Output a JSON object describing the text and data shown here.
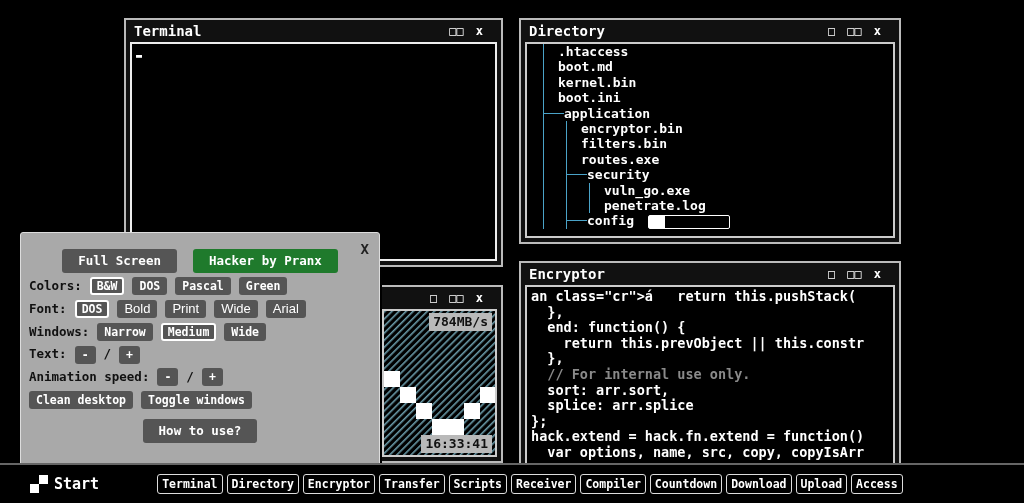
{
  "terminal": {
    "title": "Terminal",
    "buttons": [
      "□□",
      "x"
    ],
    "cursor": "▬"
  },
  "directory": {
    "title": "Directory",
    "buttons": [
      "□",
      "□□",
      "x"
    ],
    "tree": [
      {
        "name": ".htaccess",
        "kind": "file"
      },
      {
        "name": "boot.md",
        "kind": "file"
      },
      {
        "name": "kernel.bin",
        "kind": "file"
      },
      {
        "name": "boot.ini",
        "kind": "file"
      },
      {
        "name": "application",
        "kind": "folder",
        "children": [
          {
            "name": "encryptor.bin",
            "kind": "file"
          },
          {
            "name": "filters.bin",
            "kind": "file"
          },
          {
            "name": "routes.exe",
            "kind": "file"
          },
          {
            "name": "security",
            "kind": "folder",
            "children": [
              {
                "name": "vuln_go.exe",
                "kind": "file"
              },
              {
                "name": "penetrate.log",
                "kind": "file"
              }
            ]
          },
          {
            "name": "config",
            "kind": "folder",
            "level": 0.2
          }
        ]
      }
    ]
  },
  "encryptor": {
    "title": "Encryptor",
    "buttons": [
      "□",
      "□□",
      "x"
    ],
    "lines": [
      {
        "text": "an class=\"cr\">á   return this.pushStack(",
        "kind": "code"
      },
      {
        "text": "  },",
        "kind": "code"
      },
      {
        "text": "  end: function() {",
        "kind": "code"
      },
      {
        "text": "    return this.prevObject || this.constr",
        "kind": "code"
      },
      {
        "text": "  },",
        "kind": "code"
      },
      {
        "text": "  // For internal use only.",
        "kind": "comment"
      },
      {
        "text": "  sort: arr.sort,",
        "kind": "code"
      },
      {
        "text": "  splice: arr.splice",
        "kind": "code"
      },
      {
        "text": "};",
        "kind": "code"
      },
      {
        "text": "hack.extend = hack.fn.extend = function()",
        "kind": "code"
      },
      {
        "text": "  var options, name, src, copy, copyIsArr",
        "kind": "code"
      }
    ]
  },
  "transfer": {
    "buttons": [
      "□",
      "□□",
      "x"
    ],
    "speed": "784MB/s",
    "time": "16:33:41"
  },
  "settings": {
    "close": "X",
    "top_buttons": [
      {
        "label": "Full Screen",
        "kind": "plain"
      },
      {
        "label": "Hacker by Pranx",
        "kind": "accent"
      }
    ],
    "rows": [
      {
        "label": "Colors:",
        "kind": "options",
        "options": [
          {
            "label": "B&W",
            "selected": true,
            "kind": "mono"
          },
          {
            "label": "DOS",
            "selected": false,
            "kind": "mono"
          },
          {
            "label": "Pascal",
            "selected": false,
            "kind": "mono"
          },
          {
            "label": "Green",
            "selected": false,
            "kind": "mono"
          }
        ]
      },
      {
        "label": "Font:",
        "kind": "options",
        "options": [
          {
            "label": "DOS",
            "selected": true,
            "kind": "mono"
          },
          {
            "label": "Bold",
            "selected": false,
            "kind": "sans"
          },
          {
            "label": "Print",
            "selected": false,
            "kind": "sans"
          },
          {
            "label": "Wide",
            "selected": false,
            "kind": "sans"
          },
          {
            "label": "Arial",
            "selected": false,
            "kind": "sans"
          }
        ]
      },
      {
        "label": "Windows:",
        "kind": "options",
        "options": [
          {
            "label": "Narrow",
            "selected": false,
            "kind": "mono"
          },
          {
            "label": "Medium",
            "selected": true,
            "kind": "mono"
          },
          {
            "label": "Wide",
            "selected": false,
            "kind": "mono"
          }
        ]
      },
      {
        "label": "Text:",
        "kind": "stepper",
        "minus": "-",
        "separator": "/",
        "plus": "+"
      },
      {
        "label": "Animation speed:",
        "kind": "stepper",
        "minus": "-",
        "separator": "/",
        "plus": "+"
      },
      {
        "kind": "actions",
        "buttons": [
          "Clean desktop",
          "Toggle windows"
        ]
      }
    ],
    "help": "How to use?"
  },
  "taskbar": {
    "start": "Start",
    "buttons": [
      "Terminal",
      "Directory",
      "Encryptor",
      "Transfer",
      "Scripts",
      "Receiver",
      "Compiler",
      "Countdown",
      "Download",
      "Upload",
      "Access"
    ]
  }
}
